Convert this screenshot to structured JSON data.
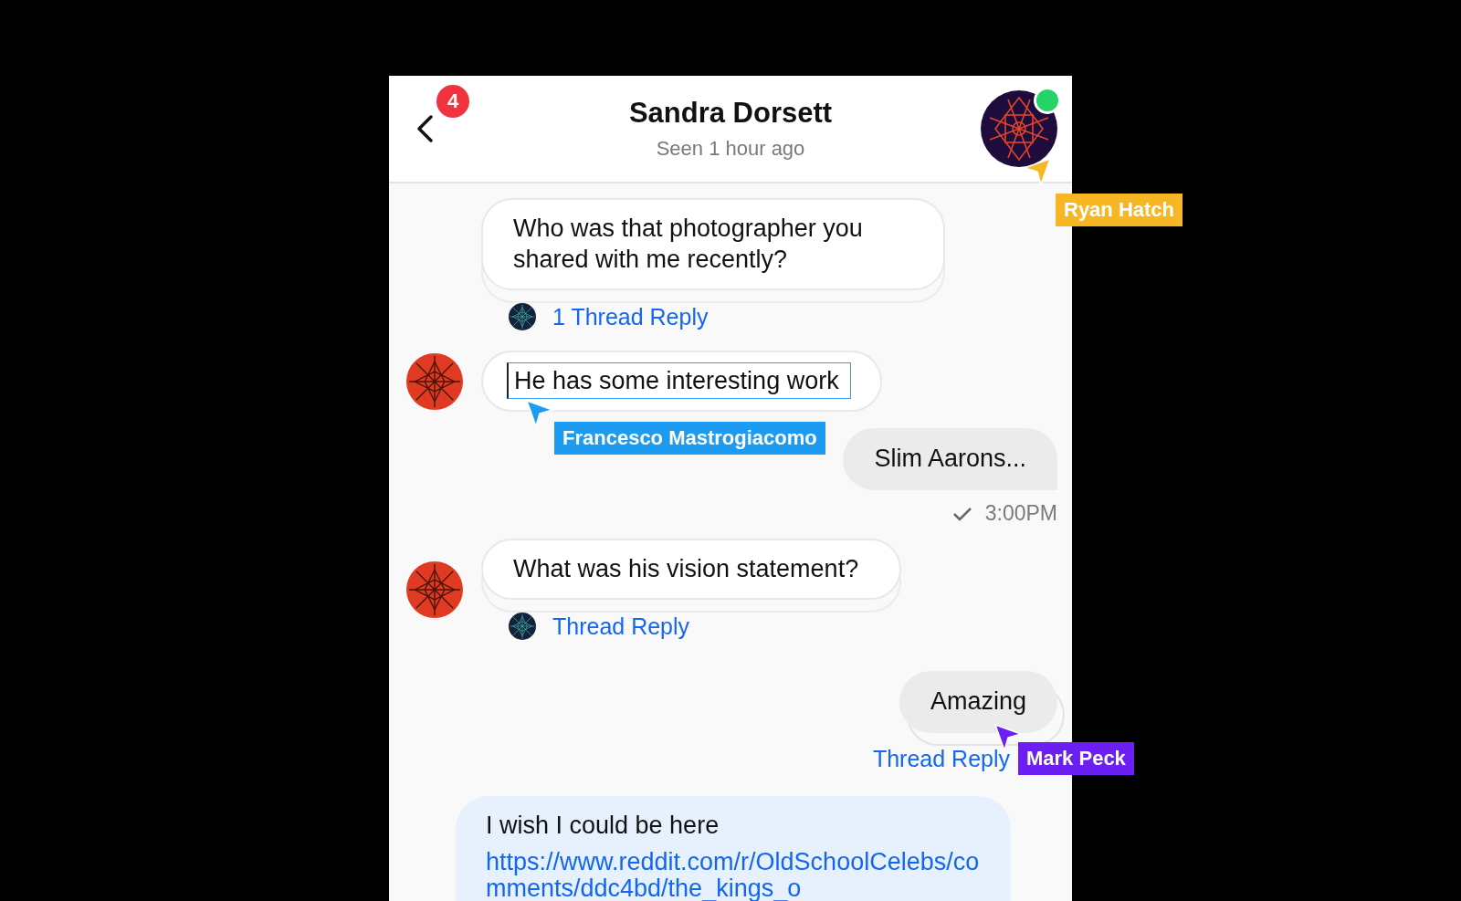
{
  "header": {
    "title": "Sandra Dorsett",
    "subtitle": "Seen 1 hour ago",
    "unread_badge": "4",
    "online": true
  },
  "messages": [
    {
      "kind": "incoming",
      "text": "Who was that photographer you shared with me recently?",
      "show_avatar": false,
      "selected": false,
      "thread": "1 Thread Reply"
    },
    {
      "kind": "incoming",
      "text": "He has some interesting work",
      "show_avatar": true,
      "selected": true
    },
    {
      "kind": "outgoing",
      "text": "Slim Aarons..."
    },
    {
      "kind": "status",
      "time": "3:00PM",
      "read": true
    },
    {
      "kind": "incoming",
      "text": "What was his vision statement?",
      "show_avatar": true,
      "selected": false,
      "thread": "Thread Reply"
    },
    {
      "kind": "outgoing",
      "text": "Amazing",
      "thread": "Thread Reply"
    },
    {
      "kind": "link",
      "text": "I wish I could be here",
      "url": "https://www.reddit.com/r/OldSchoolCelebs/comments/ddc4bd/the_kings_o"
    }
  ],
  "cursors": [
    {
      "name": "Ryan Hatch",
      "color": "#f7b623"
    },
    {
      "name": "Francesco Mastrogiacomo",
      "color": "#1d9bf0"
    },
    {
      "name": "Mark Peck",
      "color": "#6b1ff2"
    }
  ]
}
